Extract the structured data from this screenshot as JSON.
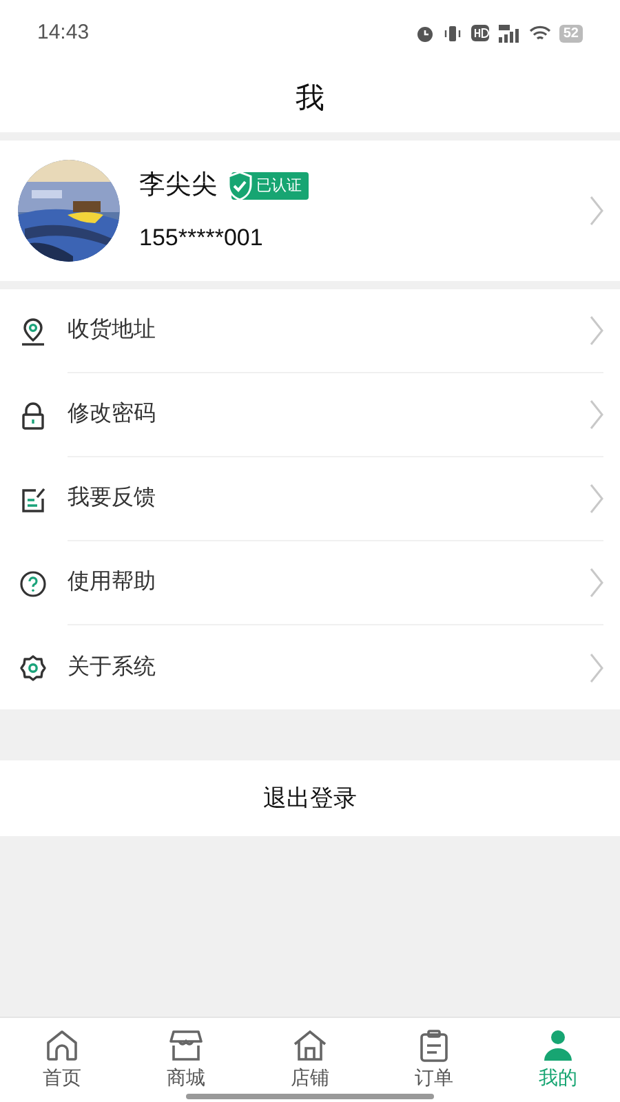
{
  "status_bar": {
    "time": "14:43",
    "battery": "52"
  },
  "header": {
    "title": "我"
  },
  "profile": {
    "name": "李尖尖",
    "badge": "已认证",
    "phone": "155*****001"
  },
  "menu": [
    {
      "kind": "location",
      "label": "收货地址"
    },
    {
      "kind": "lock",
      "label": "修改密码"
    },
    {
      "kind": "feedback",
      "label": "我要反馈"
    },
    {
      "kind": "help",
      "label": "使用帮助"
    },
    {
      "kind": "settings",
      "label": "关于系统"
    }
  ],
  "logout": "退出登录",
  "tabs": [
    {
      "kind": "home",
      "label": "首页",
      "selected": false
    },
    {
      "kind": "shop",
      "label": "商城",
      "selected": false
    },
    {
      "kind": "store",
      "label": "店铺",
      "selected": false
    },
    {
      "kind": "order",
      "label": "订单",
      "selected": false
    },
    {
      "kind": "me",
      "label": "我的",
      "selected": true
    }
  ]
}
